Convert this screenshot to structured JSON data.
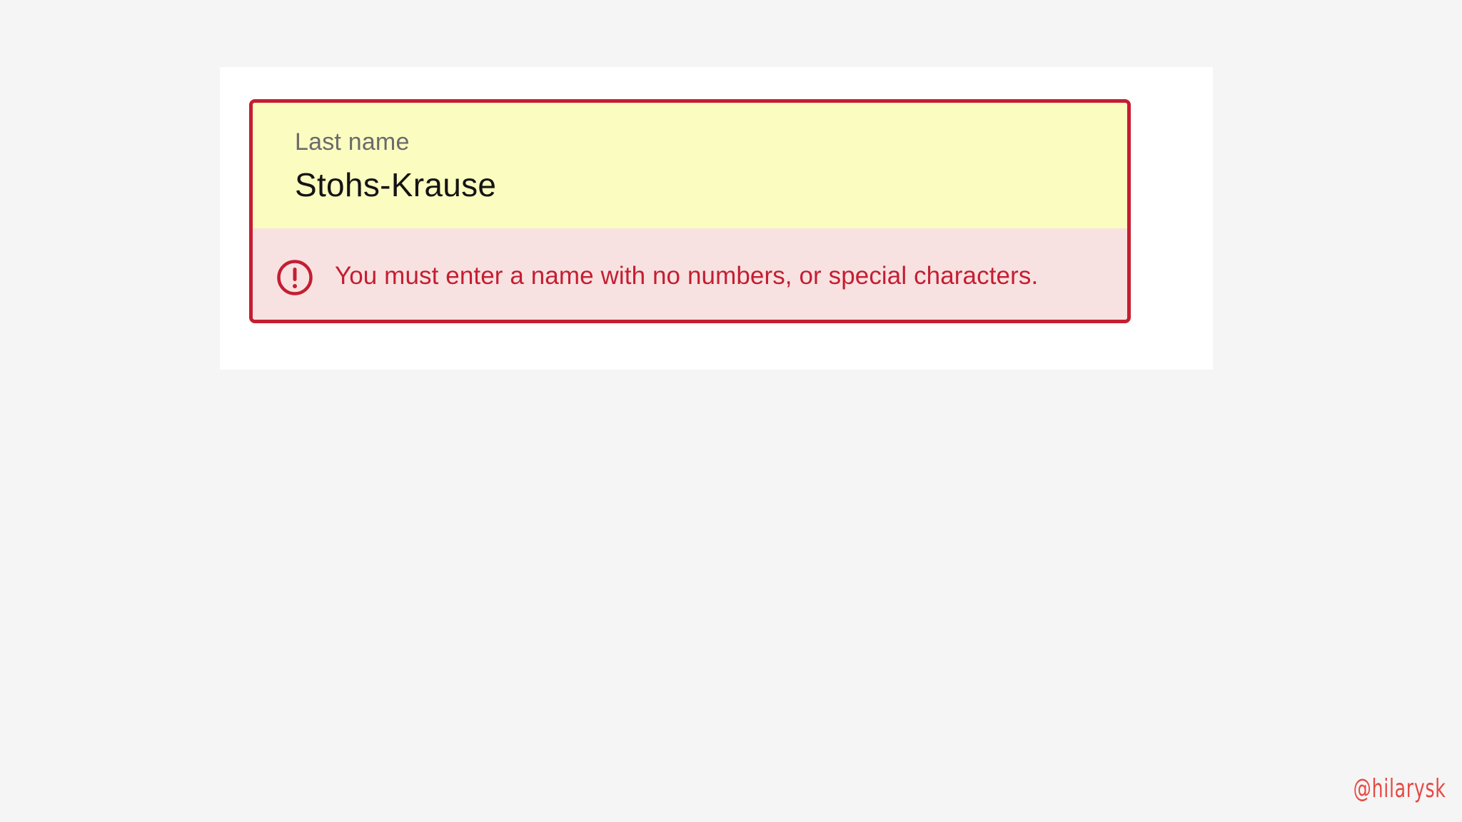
{
  "form_field": {
    "label": "Last name",
    "value": "Stohs-Krause",
    "error_icon": "exclamation-circle-icon",
    "error_message": "You must enter a name with no numbers, or special characters."
  },
  "colors": {
    "error_red": "#c41e32",
    "input_highlight": "#fbfcc0",
    "error_background": "#f8e2e1",
    "page_background": "#f5f5f5"
  },
  "watermark": "@hilarysk"
}
